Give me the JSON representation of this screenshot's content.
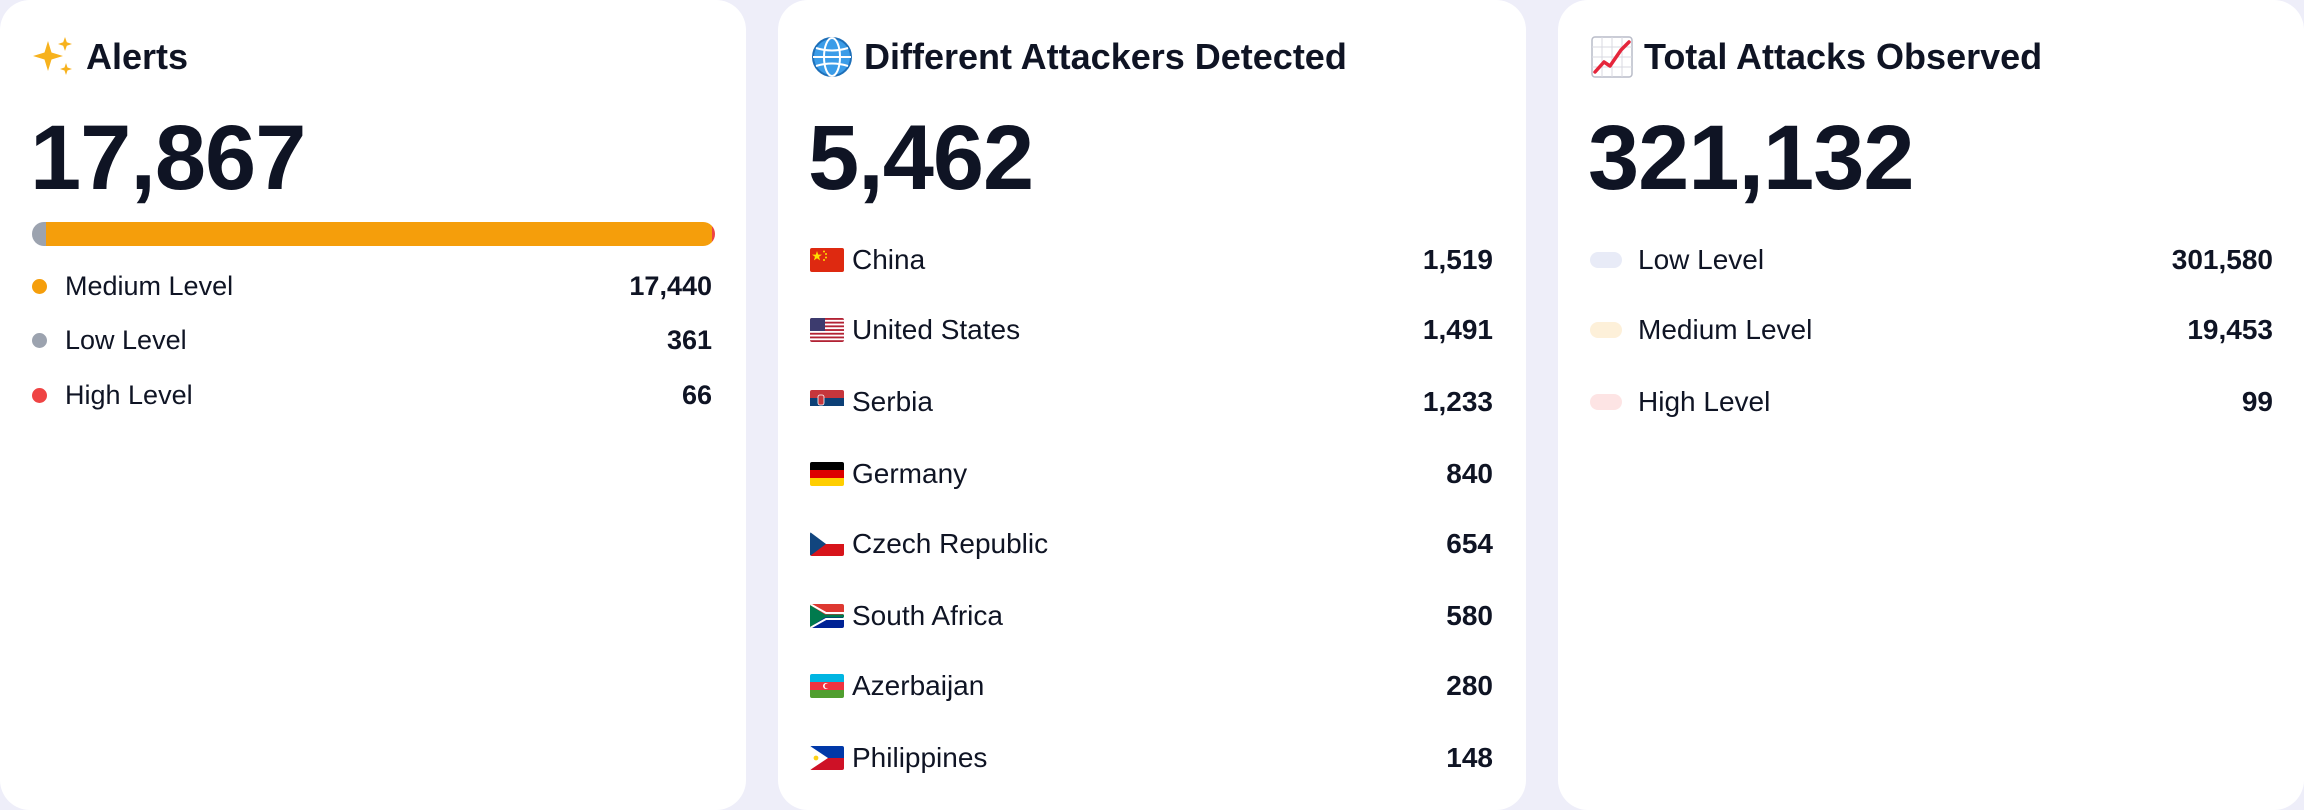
{
  "alerts": {
    "title": "Alerts",
    "icon": "sparkles-icon",
    "total": "17,867",
    "bar": {
      "low_fraction": 0.0202,
      "medium_fraction": 0.9761,
      "high_fraction": 0.0037
    },
    "rows": [
      {
        "label": "Medium Level",
        "value": "17,440",
        "color": "#f59e0b"
      },
      {
        "label": "Low Level",
        "value": "361",
        "color": "#9ca3af"
      },
      {
        "label": "High Level",
        "value": "66",
        "color": "#ef4444"
      }
    ]
  },
  "attackers": {
    "title": "Different Attackers Detected",
    "icon": "globe-icon",
    "total": "5,462",
    "countries": [
      {
        "name": "China",
        "value": "1,519",
        "flag": "china-flag-icon"
      },
      {
        "name": "United States",
        "value": "1,491",
        "flag": "united-states-flag-icon"
      },
      {
        "name": "Serbia",
        "value": "1,233",
        "flag": "serbia-flag-icon"
      },
      {
        "name": "Germany",
        "value": "840",
        "flag": "germany-flag-icon"
      },
      {
        "name": "Czech Republic",
        "value": "654",
        "flag": "czech-republic-flag-icon"
      },
      {
        "name": "South Africa",
        "value": "580",
        "flag": "south-africa-flag-icon"
      },
      {
        "name": "Azerbaijan",
        "value": "280",
        "flag": "azerbaijan-flag-icon"
      },
      {
        "name": "Philippines",
        "value": "148",
        "flag": "philippines-flag-icon"
      }
    ]
  },
  "attacks": {
    "title": "Total Attacks Observed",
    "icon": "chart-increasing-icon",
    "total": "321,132",
    "rows": [
      {
        "label": "Low Level",
        "value": "301,580",
        "color": "#e8ebf7"
      },
      {
        "label": "Medium Level",
        "value": "19,453",
        "color": "#fdf0d9"
      },
      {
        "label": "High Level",
        "value": "99",
        "color": "#fde4e4"
      }
    ]
  }
}
